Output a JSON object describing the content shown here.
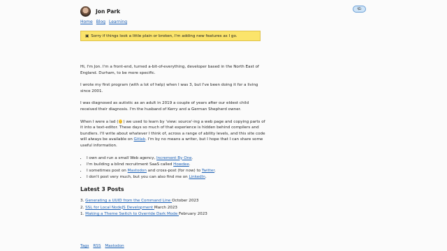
{
  "header": {
    "site_title": "Jon Park",
    "avatar_alt": "avatar"
  },
  "theme_toggle": {
    "icon": "🌤",
    "icon_name": "sun-cloud-icon"
  },
  "nav": [
    {
      "label": "Home"
    },
    {
      "label": "Blog"
    },
    {
      "label": "Learning"
    }
  ],
  "notice": {
    "icon": "▣",
    "text": "Sorry if things look a little plain or broken, I'm adding new features as I go."
  },
  "intro": [
    "Hi, I'm Jon. I'm a front-end, turned a-bit-of-everything, developer based in the North East of England. Durham, to be more specific.",
    "I wrote my first program (with a lot of help) when I was 3, but I've been doing it for a living since 2001.",
    "I was diagnosed as autistic as an adult in 2019 a couple of years after our eldest child received their diagnosis. I'm the husband of Kerry and a German Shepherd owner."
  ],
  "lad_para": {
    "part1": "When I were a lad (",
    "emoji": "👴",
    "part2": ") we used to learn by 'view: source'-ing a web page and copying parts of it into a text-editor. These days so much of that experience is hidden behind compilers and bundlers. I'll write about whatever I think of, across a range of ability levels, and this site code will always be available on ",
    "gitlab_link": "Gitlab",
    "part3": ". I'm by no means a writer, but I hope that I can share some useful information."
  },
  "list": [
    {
      "before": "I own and run a small Web agency, ",
      "link": "Increment By One",
      "after": "."
    },
    {
      "before": "I'm building a blind recruitment ",
      "abbr": "SaaS",
      "middle": " called ",
      "link": "Howdee",
      "after": "."
    },
    {
      "before": "I sometimes post on ",
      "link": "Mastodon",
      "middle": " and cross-post (for now) to ",
      "link2": "Twitter",
      "after": "."
    },
    {
      "before": "I don't post very much, but you can also find me on ",
      "link": "LinkedIn",
      "after": "."
    }
  ],
  "posts_heading": "Latest 3 Posts",
  "posts": [
    {
      "num": "3.",
      "title": "Generating a UUID from the Command Line ",
      "date": "October 2023"
    },
    {
      "num": "2.",
      "title": "SSL for Local NodeJS Development ",
      "date": "March 2023"
    },
    {
      "num": "1.",
      "title": "Making a Theme Switch to Override Dark Mode ",
      "date": "February 2023"
    }
  ],
  "footer": [
    {
      "label": "Tags"
    },
    {
      "label": "RSS"
    },
    {
      "label": "Mastodon"
    }
  ]
}
